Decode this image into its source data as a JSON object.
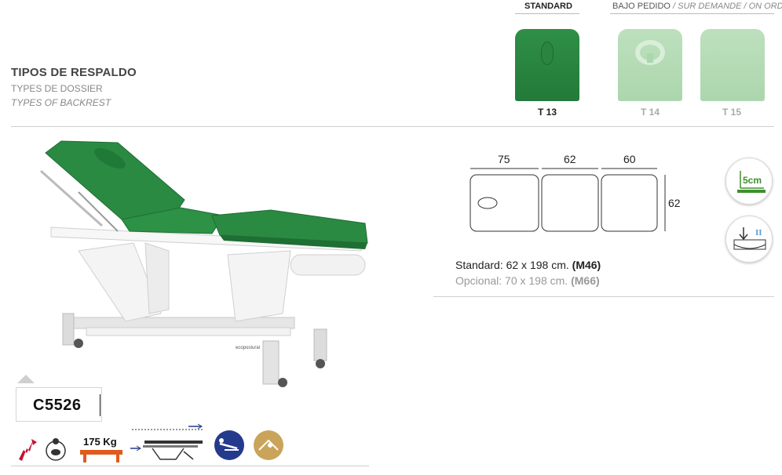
{
  "backrest": {
    "title": "TIPOS DE RESPALDO",
    "subtitle_fr": "TYPES DE DOSSIER",
    "subtitle_en": "TYPES OF BACKREST",
    "standard_label": "STANDARD",
    "order_label_es": "BAJO PEDIDO",
    "order_label_fr": "/ SUR DEMANDE /",
    "order_label_en": "ON ORDER",
    "options": [
      {
        "code": "T 13",
        "color": "#2a8a42"
      },
      {
        "code": "T 14",
        "color": "#b5dcb5"
      },
      {
        "code": "T 15",
        "color": "#b5dcb5"
      }
    ]
  },
  "dimensions": {
    "section_1": "75",
    "section_2": "62",
    "section_3": "60",
    "width": "62"
  },
  "specs": {
    "standard_prefix": "Standard: 62 x 198 cm.",
    "standard_code": "(M46)",
    "optional_prefix": "Opcional: 70 x 198 cm.",
    "optional_code": "(M66)"
  },
  "badges": {
    "padding": "5cm"
  },
  "model": {
    "code": "C5526"
  },
  "features": {
    "max_weight": "175 Kg"
  },
  "colors": {
    "upholstery": "#2a8a42",
    "frame": "#eeeeee",
    "accent_blue": "#243a8c",
    "accent_gold": "#c9a45a",
    "accent_red": "#c4122f"
  }
}
